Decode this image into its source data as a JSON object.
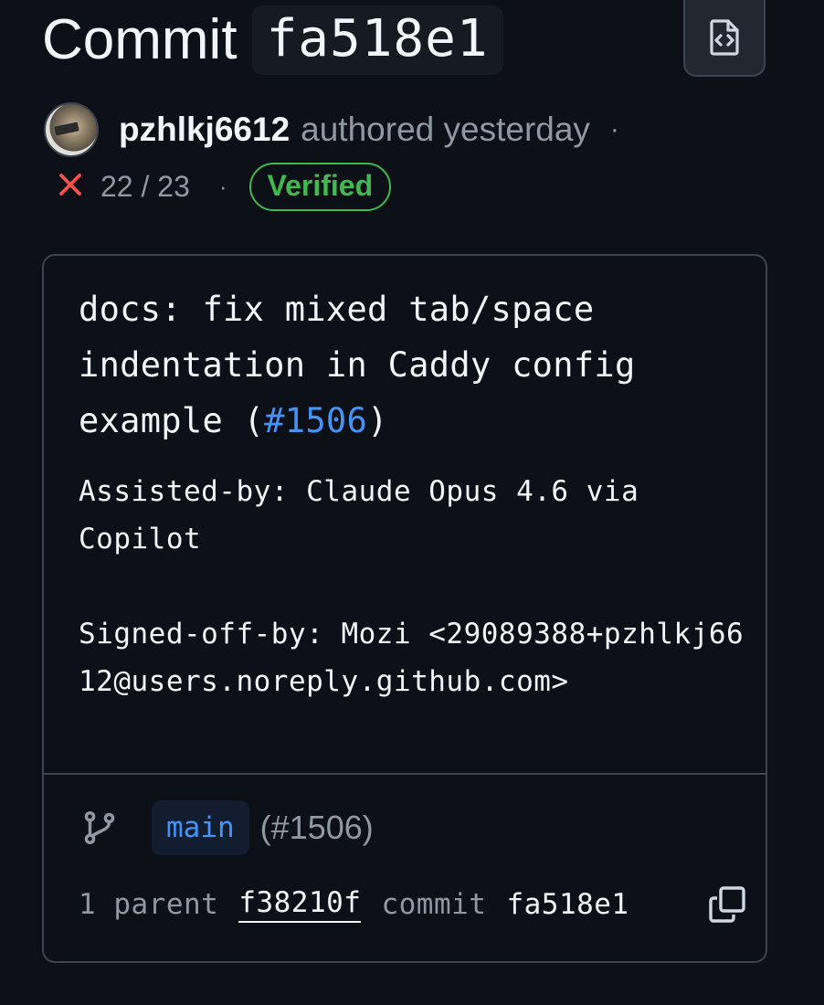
{
  "header": {
    "title_word": "Commit",
    "sha": "fa518e1",
    "browse_icon": "file-code-icon"
  },
  "author": {
    "name": "pzhlkj6612",
    "action": "authored yesterday",
    "separator": "·",
    "avatar_icon": "avatar-image"
  },
  "status": {
    "checks_icon": "x-icon",
    "checks_text": "22 / 23",
    "separator": "·",
    "verified_label": "Verified",
    "colors": {
      "fail": "#f85149",
      "verified": "#3fb950",
      "link": "#4493f8"
    }
  },
  "message": {
    "title_text": "docs: fix mixed tab/space indentation in Caddy config example (",
    "title_link": "#1506",
    "title_end": ")",
    "body_line1": "Assisted-by: Claude Opus 4.6 via Copilot",
    "body_line2": "Signed-off-by: Mozi <29089388+pzhlkj6612@users.noreply.github.com>"
  },
  "branch": {
    "icon": "git-branch-icon",
    "name": "main",
    "pr": "(#1506)"
  },
  "parents": {
    "count_label": "1 parent",
    "parent_sha": "f38210f",
    "commit_label": "commit",
    "commit_sha": "fa518e1",
    "copy_icon": "copy-icon"
  }
}
